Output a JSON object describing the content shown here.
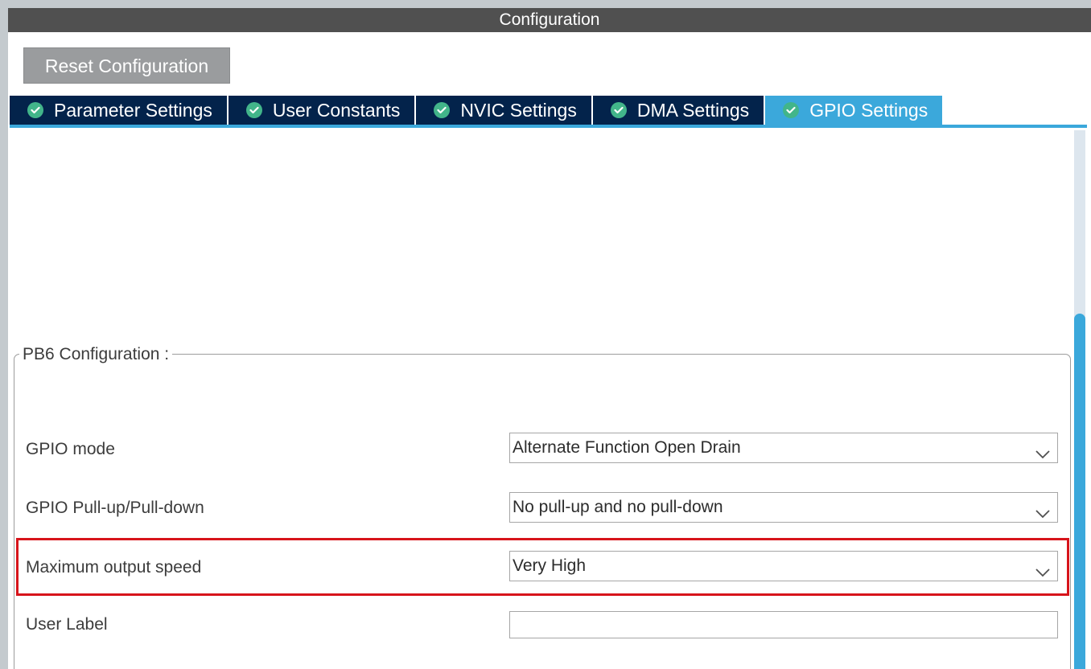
{
  "window": {
    "title": "Configuration"
  },
  "toolbar": {
    "reset_label": "Reset Configuration"
  },
  "tabs": [
    {
      "label": "Parameter Settings",
      "active": false,
      "icon": "check-circle-icon"
    },
    {
      "label": "User Constants",
      "active": false,
      "icon": "check-circle-icon"
    },
    {
      "label": "NVIC Settings",
      "active": false,
      "icon": "check-circle-icon"
    },
    {
      "label": "DMA Settings",
      "active": false,
      "icon": "check-circle-icon"
    },
    {
      "label": "GPIO Settings",
      "active": true,
      "icon": "check-circle-icon"
    }
  ],
  "group": {
    "title": "PB6 Configuration :",
    "rows": [
      {
        "label": "GPIO mode",
        "value": "Alternate Function Open Drain"
      },
      {
        "label": "GPIO Pull-up/Pull-down",
        "value": "No pull-up and no pull-down"
      },
      {
        "label": "Maximum output speed",
        "value": "Very High"
      },
      {
        "label": "User Label",
        "value": ""
      }
    ]
  },
  "colors": {
    "accent": "#3ba8db",
    "tab_background": "#03234b",
    "highlight": "#d7141b",
    "check_icon": "#42b58a"
  }
}
